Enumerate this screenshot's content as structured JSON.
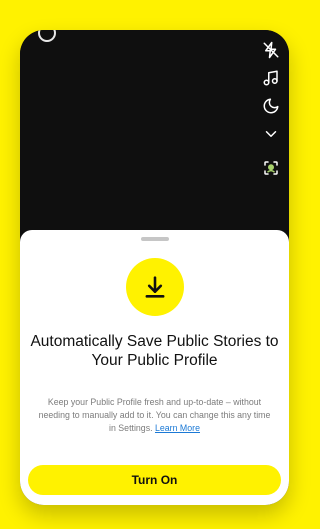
{
  "colors": {
    "brand_yellow": "#FFF200",
    "camera_bg": "#0f0f0f",
    "sheet_bg": "#ffffff",
    "link": "#1b79d6"
  },
  "camera": {
    "toolbar_icons": [
      "flash-off-icon",
      "music-note-icon",
      "moon-icon",
      "chevron-down-icon",
      "lens-scan-icon"
    ]
  },
  "sheet": {
    "icon": "download-icon",
    "headline": "Automatically Save Public Stories to Your Public Profile",
    "body": "Keep your Public Profile fresh and up-to-date – without needing to manually add to it. You can change this any time in Settings. ",
    "link_text": "Learn More",
    "cta_label": "Turn On"
  }
}
